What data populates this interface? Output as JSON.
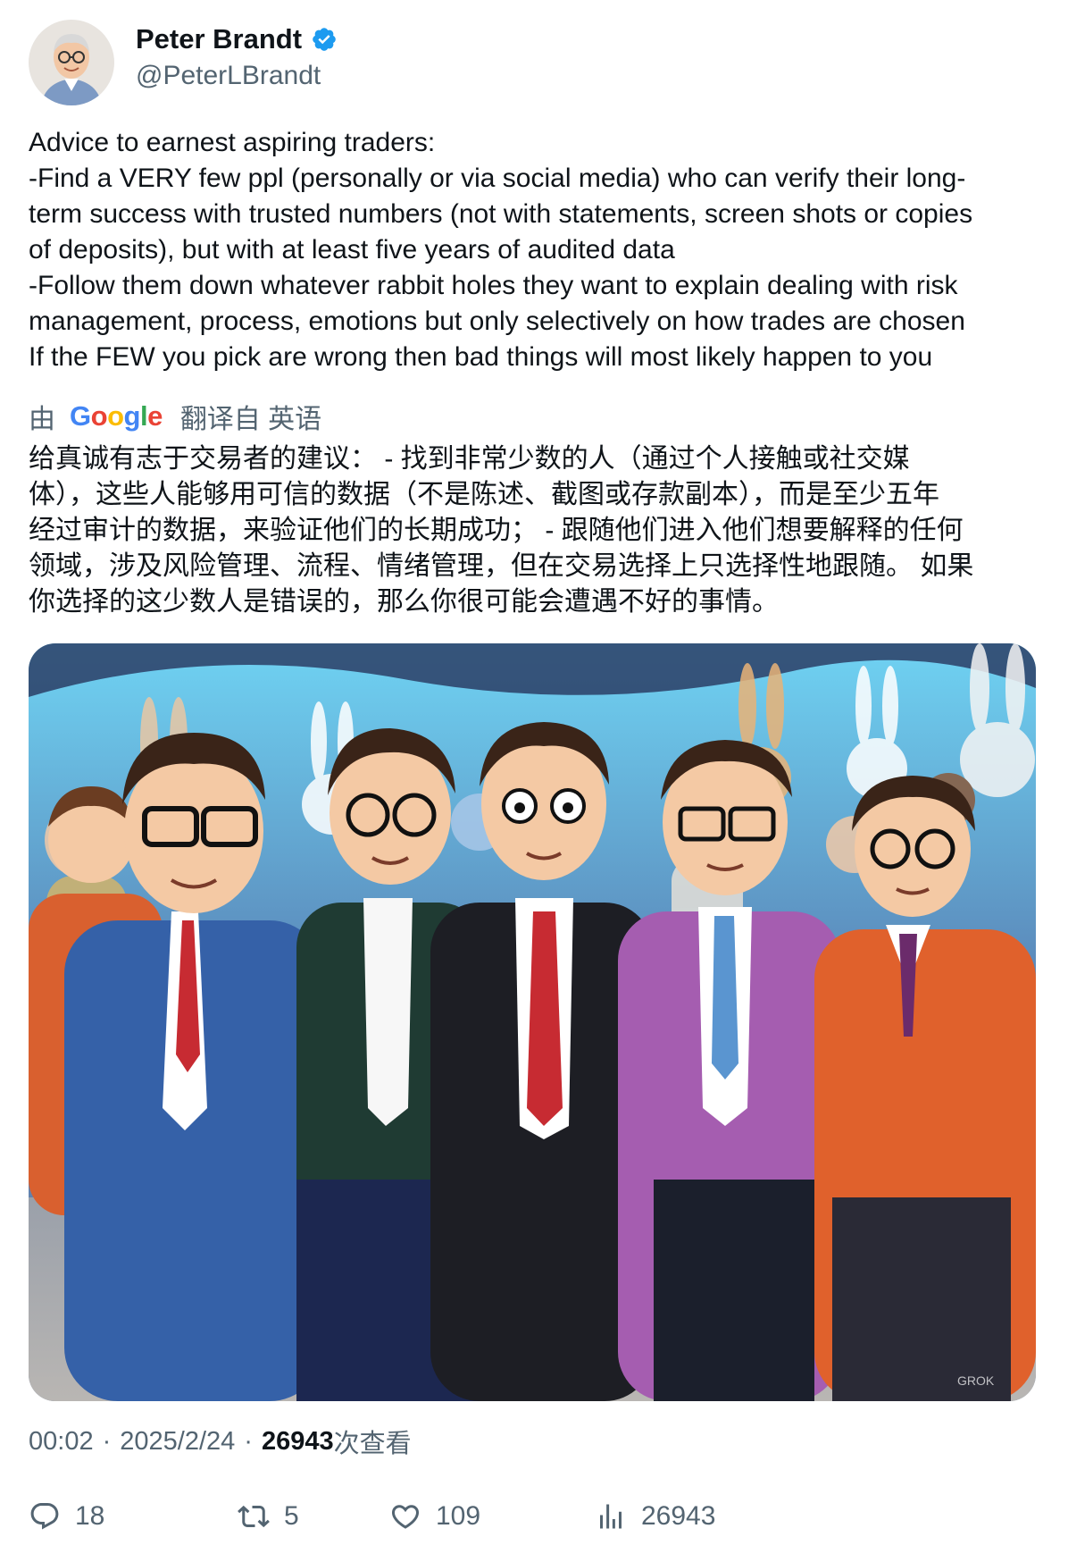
{
  "author": {
    "name": "Peter Brandt",
    "handle": "@PeterLBrandt",
    "verified": true
  },
  "tweet": {
    "lines": [
      "Advice to earnest aspiring traders:",
      "-Find a VERY few ppl (personally or via social media) who can verify their long-",
      "term success with trusted numbers (not with statements, screen shots or copies",
      "of deposits), but with at least five years of audited data",
      "-Follow them down whatever rabbit holes they want to explain dealing with risk",
      "management, process, emotions but only selectively on how trades are chosen",
      "If the FEW you pick are wrong then bad things will most likely happen to you"
    ]
  },
  "translation": {
    "prefix": "由",
    "provider": "Google",
    "label": "翻译自 英语",
    "lines": [
      "给真诚有志于交易者的建议： - 找到非常少数的人（通过个人接触或社交媒",
      "体），这些人能够用可信的数据（不是陈述、截图或存款副本），而是至少五年",
      "经过审计的数据，来验证他们的长期成功； - 跟随他们进入他们想要解释的任何",
      "领域，涉及风险管理、流程、情绪管理，但在交易选择上只选择性地跟随。 如果",
      "你选择的这少数人是错误的，那么你很可能会遭遇不好的事情。"
    ]
  },
  "media": {
    "watermark": "GROK"
  },
  "meta": {
    "time": "00:02",
    "date": "2025/2/24",
    "views": "26943",
    "views_label": "次查看",
    "separator": "·"
  },
  "actions": {
    "replies": "18",
    "retweets": "5",
    "likes": "109",
    "views": "26943"
  },
  "colors": {
    "verified": "#1d9bf0",
    "secondary_text": "#536471",
    "primary_text": "#0f1419"
  },
  "icons": [
    "verified-badge-icon",
    "reply-icon",
    "retweet-icon",
    "like-icon",
    "views-chart-icon"
  ]
}
